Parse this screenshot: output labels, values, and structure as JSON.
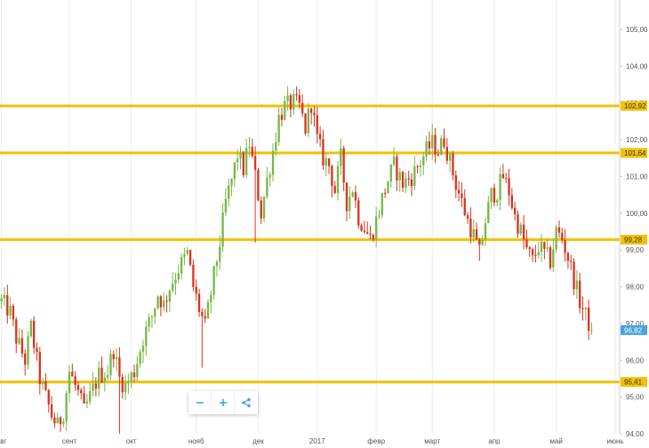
{
  "chart_data": {
    "type": "candlestick",
    "y_axis": {
      "position": "right",
      "range": [
        94.0,
        105.8
      ],
      "ticks": [
        "94,00",
        "95,00",
        "96,00",
        "97,00",
        "98,00",
        "99,00",
        "100,00",
        "101,00",
        "102,00",
        "103,00",
        "104,00",
        "105,00"
      ],
      "tick_values": [
        94,
        95,
        96,
        97,
        98,
        99,
        100,
        101,
        102,
        103,
        104,
        105
      ]
    },
    "x_axis": {
      "labels": [
        "авг",
        "сент",
        "окт",
        "нояб",
        "дек",
        "2017",
        "февр",
        "март",
        "апр",
        "май",
        "июнь"
      ],
      "label_positions": [
        0,
        23,
        44,
        66,
        87,
        107,
        127,
        146,
        167,
        188,
        208
      ],
      "total_bars": 210
    },
    "grid": {
      "vertical": true,
      "horizontal": false
    },
    "levels": [
      {
        "value": 102.92,
        "label": "102,92"
      },
      {
        "value": 101.64,
        "label": "101,64"
      },
      {
        "value": 99.28,
        "label": "99,28"
      },
      {
        "value": 95.41,
        "label": "95,41"
      }
    ],
    "last_price": {
      "value": 96.82,
      "label": "96,82"
    },
    "colors": {
      "up": "#76b947",
      "down": "#d9341f",
      "level": "#f2c200",
      "last_price": "#4aa3df",
      "grid": "#ececec",
      "axis": "#cfcfcf"
    },
    "series": [
      {
        "path": [
          [
            0,
            97.6
          ],
          [
            3,
            97.3
          ],
          [
            5,
            96.6
          ],
          [
            8,
            96.0
          ],
          [
            10,
            96.9
          ],
          [
            13,
            95.5
          ],
          [
            15,
            95.0
          ],
          [
            17,
            94.5
          ],
          [
            19,
            94.2
          ],
          [
            21,
            94.6
          ],
          [
            23,
            95.7
          ],
          [
            26,
            95.1
          ],
          [
            28,
            94.6
          ],
          [
            31,
            95.2
          ],
          [
            33,
            95.6
          ],
          [
            36,
            95.7
          ],
          [
            38,
            96.3
          ],
          [
            40,
            95.5
          ],
          [
            42,
            95.3
          ],
          [
            45,
            95.7
          ],
          [
            48,
            96.6
          ],
          [
            51,
            97.2
          ],
          [
            53,
            97.8
          ],
          [
            55,
            97.5
          ],
          [
            57,
            98.0
          ],
          [
            60,
            98.5
          ],
          [
            63,
            98.9
          ],
          [
            65,
            98.0
          ],
          [
            67,
            97.4
          ],
          [
            69,
            96.9
          ],
          [
            72,
            98.3
          ],
          [
            74,
            99.2
          ],
          [
            76,
            100.3
          ],
          [
            78,
            100.9
          ],
          [
            80,
            101.6
          ],
          [
            82,
            101.2
          ],
          [
            84,
            101.9
          ],
          [
            86,
            101.0
          ],
          [
            88,
            100.0
          ],
          [
            90,
            100.9
          ],
          [
            92,
            101.7
          ],
          [
            94,
            102.6
          ],
          [
            96,
            102.9
          ],
          [
            99,
            103.0
          ],
          [
            101,
            102.9
          ],
          [
            103,
            102.3
          ],
          [
            105,
            103.0
          ],
          [
            107,
            102.0
          ],
          [
            109,
            101.5
          ],
          [
            111,
            101.3
          ],
          [
            113,
            100.6
          ],
          [
            115,
            101.5
          ],
          [
            117,
            100.3
          ],
          [
            119,
            100.7
          ],
          [
            121,
            99.9
          ],
          [
            123,
            99.6
          ],
          [
            125,
            99.3
          ],
          [
            127,
            99.8
          ],
          [
            129,
            100.4
          ],
          [
            131,
            100.9
          ],
          [
            133,
            101.3
          ],
          [
            136,
            100.8
          ],
          [
            139,
            101.0
          ],
          [
            142,
            101.4
          ],
          [
            144,
            101.7
          ],
          [
            146,
            101.9
          ],
          [
            148,
            101.7
          ],
          [
            150,
            102.0
          ],
          [
            152,
            101.4
          ],
          [
            154,
            100.8
          ],
          [
            156,
            100.3
          ],
          [
            158,
            99.8
          ],
          [
            160,
            99.4
          ],
          [
            162,
            98.9
          ],
          [
            164,
            99.8
          ],
          [
            166,
            100.5
          ],
          [
            168,
            100.6
          ],
          [
            170,
            101.0
          ],
          [
            172,
            100.6
          ],
          [
            174,
            99.9
          ],
          [
            176,
            99.5
          ],
          [
            178,
            99.0
          ],
          [
            180,
            98.7
          ],
          [
            182,
            99.1
          ],
          [
            184,
            98.9
          ],
          [
            186,
            98.7
          ],
          [
            188,
            99.5
          ],
          [
            190,
            99.3
          ],
          [
            192,
            98.8
          ],
          [
            194,
            98.2
          ],
          [
            196,
            97.6
          ],
          [
            198,
            97.2
          ],
          [
            200,
            96.82
          ]
        ],
        "outliers": [
          {
            "i": 40,
            "low": 94.0
          },
          {
            "i": 68,
            "low": 95.8
          },
          {
            "i": 86,
            "low": 99.2
          },
          {
            "i": 162,
            "low": 98.7
          }
        ]
      }
    ]
  },
  "toolbar": {
    "zoom_out_icon": "minus-icon",
    "zoom_in_icon": "plus-icon",
    "share_icon": "share-icon"
  }
}
